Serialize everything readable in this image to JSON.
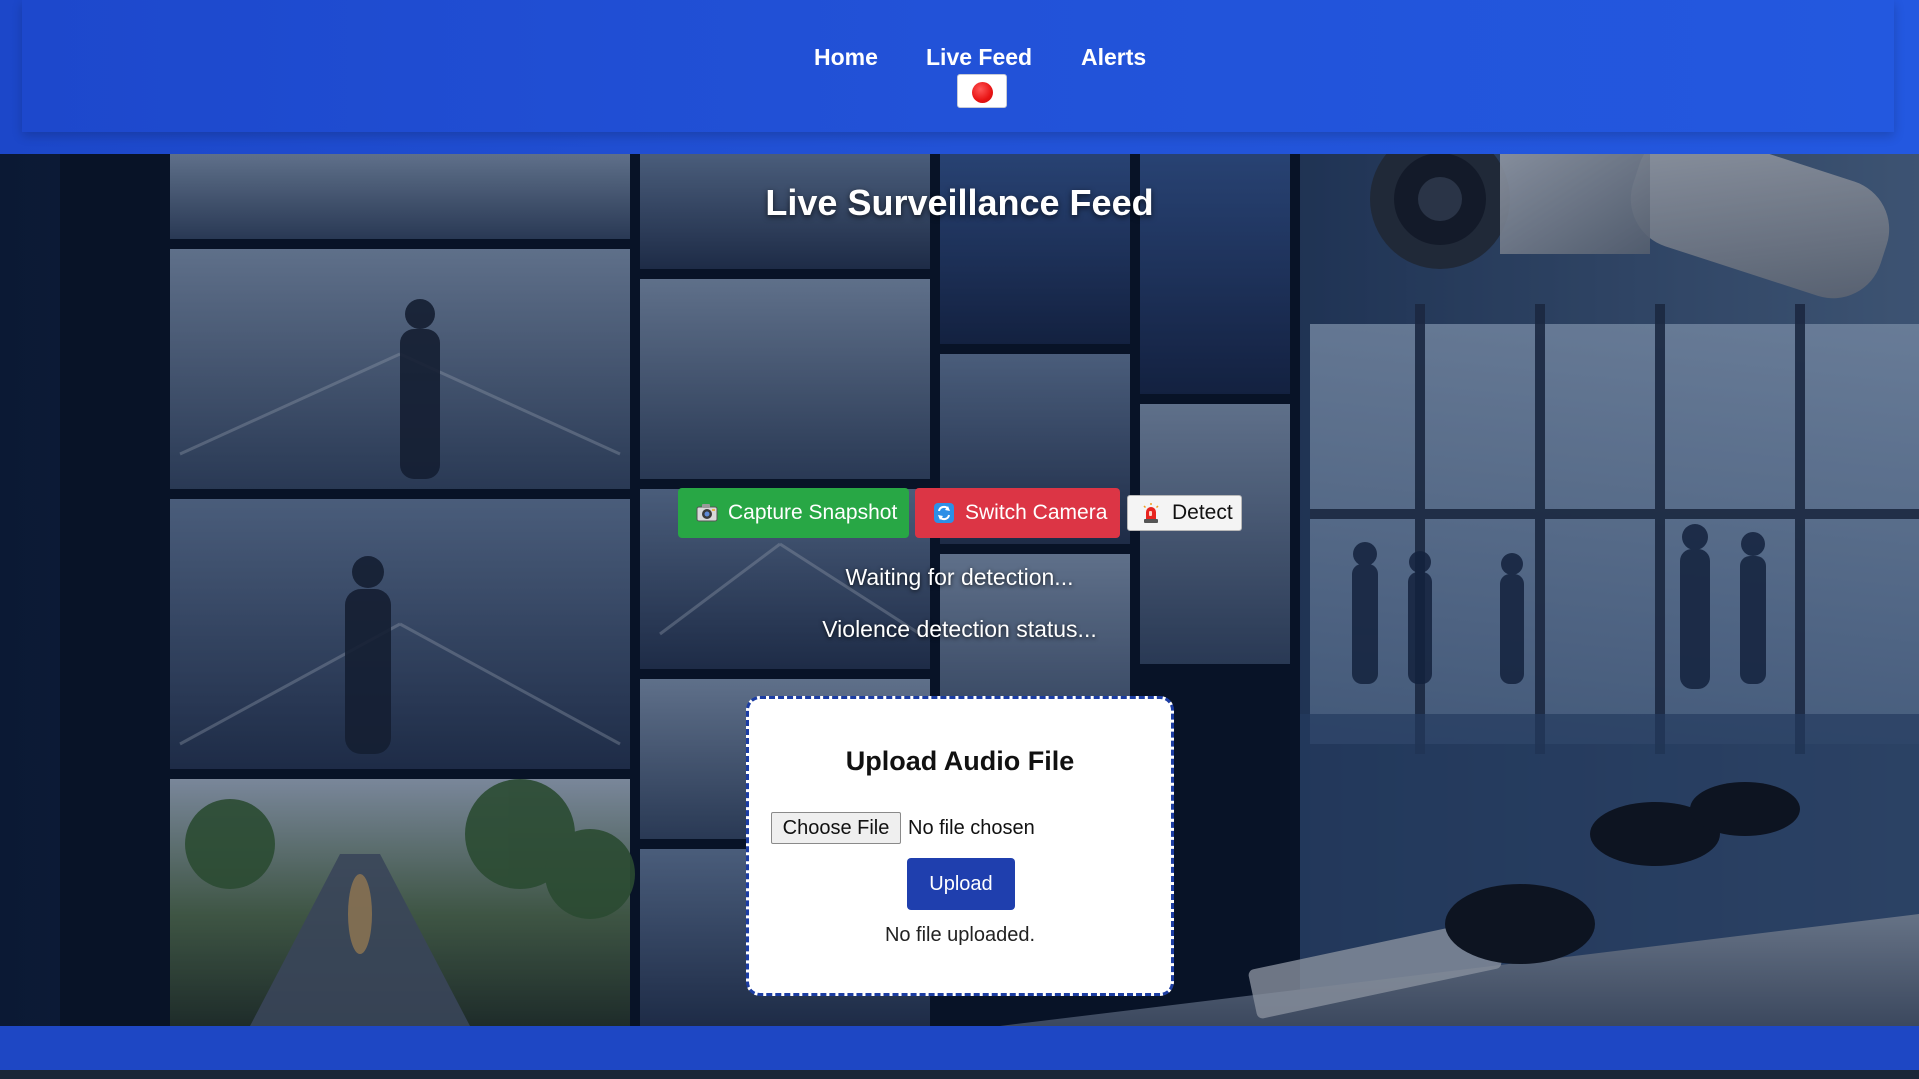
{
  "nav": {
    "items": [
      {
        "label": "Home"
      },
      {
        "label": "Live Feed"
      },
      {
        "label": "Alerts"
      }
    ],
    "record_icon": "record-dot-icon"
  },
  "main": {
    "title": "Live Surveillance Feed",
    "buttons": {
      "capture": {
        "label": "Capture Snapshot",
        "icon": "camera-icon"
      },
      "switch": {
        "label": "Switch Camera",
        "icon": "switch-camera-icon"
      },
      "detect": {
        "label": "Detect",
        "icon": "siren-icon"
      }
    },
    "status": {
      "waiting": "Waiting for detection...",
      "violence": "Violence detection status..."
    }
  },
  "upload": {
    "title": "Upload Audio File",
    "choose_label": "Choose File",
    "file_status": "No file chosen",
    "upload_label": "Upload",
    "upload_status": "No file uploaded."
  },
  "colors": {
    "header_blue": "#2252d6",
    "capture_green": "#28a745",
    "switch_red": "#dc3545",
    "upload_blue": "#1f3fae",
    "footer_blue": "#1e47c4"
  }
}
